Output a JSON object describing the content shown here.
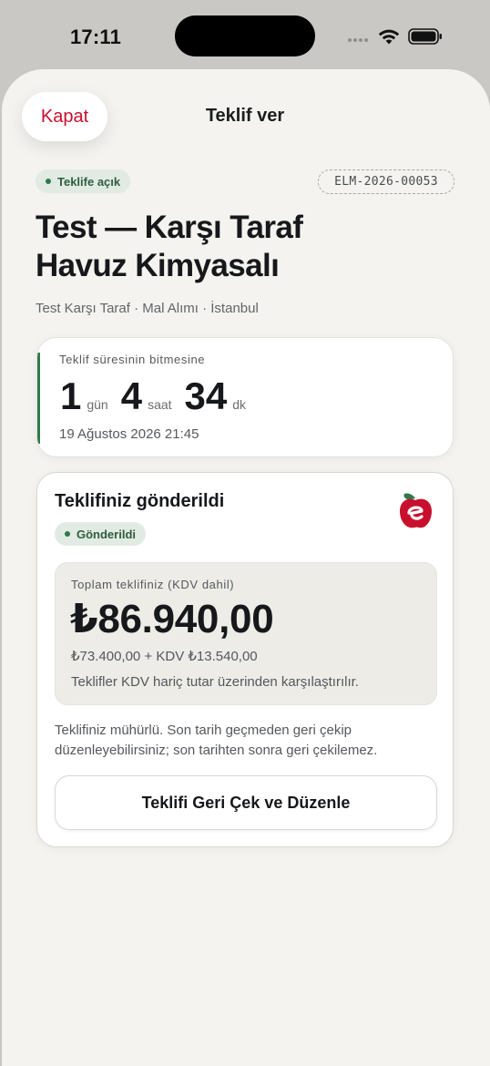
{
  "status_bar": {
    "time": "17:11"
  },
  "header": {
    "close_label": "Kapat",
    "title": "Teklif ver"
  },
  "tender": {
    "status_label": "Teklife açık",
    "reference": "ELM-2026-00053",
    "title_line1": "Test — Karşı Taraf",
    "title_line2": "Havuz Kimyasalı",
    "meta": "Test Karşı Taraf · Mal Alımı · İstanbul"
  },
  "countdown": {
    "label": "Teklif süresinin bitmesine",
    "days": "1",
    "days_unit": "gün",
    "hours": "4",
    "hours_unit": "saat",
    "minutes": "34",
    "minutes_unit": "dk",
    "deadline": "19 Ağustos 2026 21:45"
  },
  "offer": {
    "title": "Teklifiniz gönderildi",
    "status_label": "Gönderildi",
    "total_label": "Toplam teklifiniz (KDV dahil)",
    "total_amount": "₺86.940,00",
    "breakdown": "₺73.400,00 + KDV ₺13.540,00",
    "comparison_note": "Teklifler KDV hariç tutar üzerinden karşılaştırılır.",
    "seal_note": "Teklifiniz mühürlü. Son tarih geçmeden geri çekip düzenleyebilirsiniz; son tarihten sonra geri çekilemez.",
    "withdraw_label": "Teklifi Geri Çek ve Düzenle"
  },
  "colors": {
    "accent_red": "#c8102e",
    "accent_green": "#2f7a4a",
    "sheet_bg": "#f4f3ef",
    "pill_bg": "#e1ebe3"
  },
  "icons": {
    "wifi": "wifi-icon",
    "battery": "battery-icon",
    "signal": "cellular-signal-icon",
    "logo": "apple-e-logo"
  }
}
